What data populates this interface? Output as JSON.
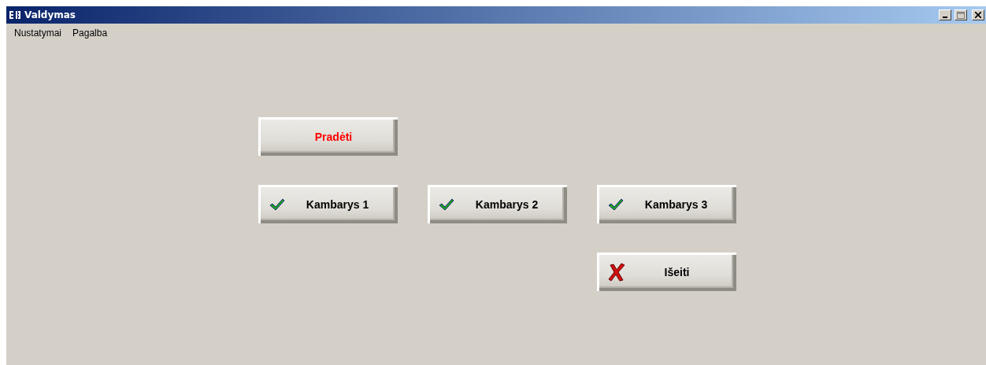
{
  "window": {
    "title": "Valdymas"
  },
  "menu": [
    {
      "label": "Nustatymai"
    },
    {
      "label": "Pagalba"
    }
  ],
  "buttons": [
    {
      "kind": "start",
      "label": "Pradėti"
    },
    {
      "kind": "check",
      "label": "Kambarys 1"
    },
    {
      "kind": "check",
      "label": "Kambarys 2"
    },
    {
      "kind": "check",
      "label": "Kambarys 3"
    },
    {
      "kind": "exit",
      "label": "Išeiti"
    }
  ]
}
